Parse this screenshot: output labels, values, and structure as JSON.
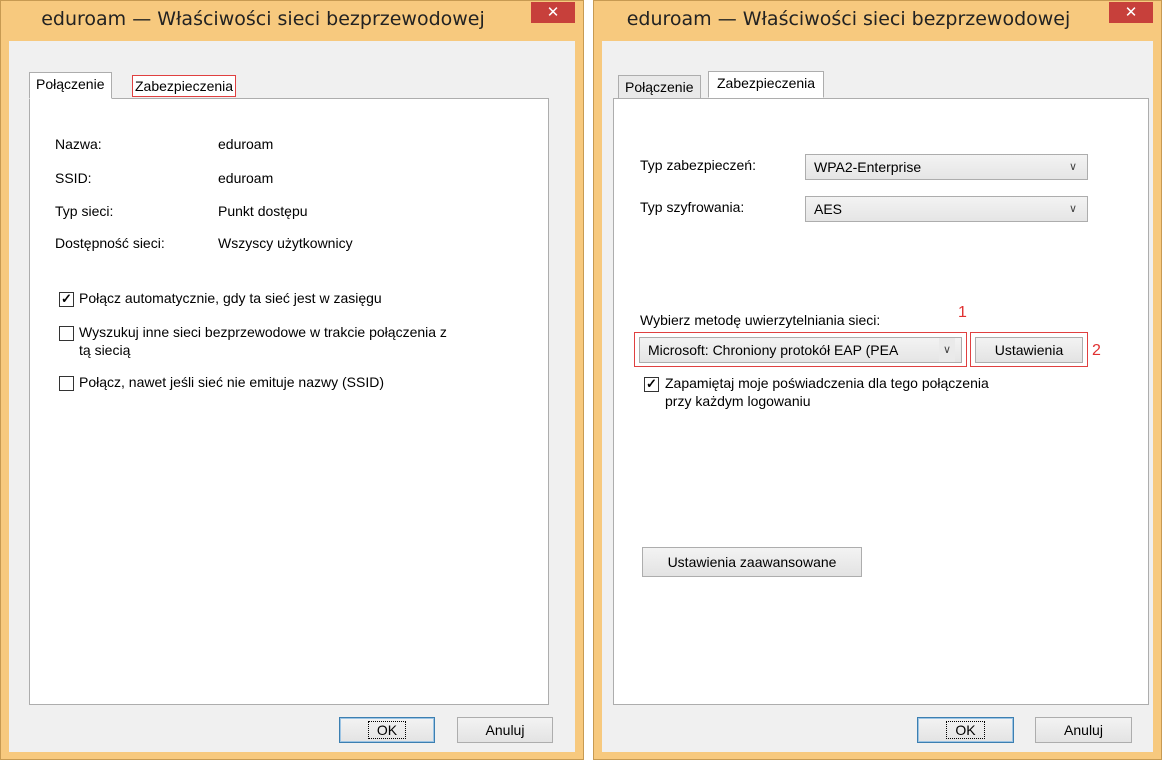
{
  "left_window": {
    "title": "eduroam — Właściwości sieci bezprzewodowej",
    "close_glyph": "✕",
    "tabs": [
      {
        "label": "Połączenie",
        "active": true
      },
      {
        "label": "Zabezpieczenia",
        "active": false
      }
    ],
    "info": [
      {
        "label": "Nazwa:",
        "value": "eduroam"
      },
      {
        "label": "SSID:",
        "value": "eduroam"
      },
      {
        "label": "Typ sieci:",
        "value": "Punkt dostępu"
      },
      {
        "label": "Dostępność sieci:",
        "value": "Wszyscy użytkownicy"
      }
    ],
    "checkboxes": [
      {
        "label": "Połącz automatycznie, gdy ta sieć jest w zasięgu",
        "checked": true
      },
      {
        "label": "Wyszukuj inne sieci bezprzewodowe w trakcie połączenia z",
        "label2": "tą siecią",
        "checked": false
      },
      {
        "label": "Połącz, nawet jeśli sieć nie emituje nazwy (SSID)",
        "checked": false
      }
    ],
    "ok_label": "OK",
    "cancel_label": "Anuluj"
  },
  "right_window": {
    "title": "eduroam — Właściwości sieci bezprzewodowej",
    "close_glyph": "✕",
    "tabs": [
      {
        "label": "Połączenie",
        "active": false
      },
      {
        "label": "Zabezpieczenia",
        "active": true
      }
    ],
    "security_type_label": "Typ zabezpieczeń:",
    "security_type_value": "WPA2-Enterprise",
    "encryption_type_label": "Typ szyfrowania:",
    "encryption_type_value": "AES",
    "auth_method_label": "Wybierz metodę uwierzytelniania sieci:",
    "auth_method_value": "Microsoft: Chroniony protokół EAP (PEA",
    "settings_label": "Ustawienia",
    "remember_label": "Zapamiętaj moje poświadczenia dla tego połączenia",
    "remember_label2": "przy każdym logowaniu",
    "remember_checked": true,
    "advanced_label": "Ustawienia zaawansowane",
    "annotation_1": "1",
    "annotation_2": "2",
    "ok_label": "OK",
    "cancel_label": "Anuluj"
  },
  "icons": {
    "dropdown": "∨",
    "check": "✓"
  },
  "colors": {
    "frame": "#f7c97e",
    "close_button": "#c7403b",
    "highlight": "#e04040"
  }
}
